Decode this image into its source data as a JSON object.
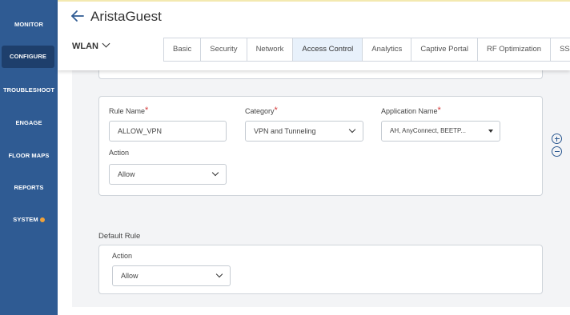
{
  "sidebar": {
    "items": [
      {
        "label": "MONITOR"
      },
      {
        "label": "CONFIGURE",
        "active": true
      },
      {
        "label": "TROUBLESHOOT"
      },
      {
        "label": "ENGAGE"
      },
      {
        "label": "FLOOR MAPS"
      },
      {
        "label": "REPORTS"
      },
      {
        "label": "SYSTEM",
        "badge_color": "#f0a23a"
      }
    ]
  },
  "header": {
    "title": "AristaGuest",
    "back_icon": "arrow-left-icon",
    "selector_label": "WLAN"
  },
  "tabs": [
    {
      "label": "Basic"
    },
    {
      "label": "Security"
    },
    {
      "label": "Network"
    },
    {
      "label": "Access Control",
      "active": true
    },
    {
      "label": "Analytics"
    },
    {
      "label": "Captive Portal"
    },
    {
      "label": "RF Optimization"
    },
    {
      "label": "SSID S"
    }
  ],
  "rule": {
    "rule_name_label": "Rule Name",
    "rule_name_value": "ALLOW_VPN",
    "category_label": "Category",
    "category_value": "VPN and Tunneling",
    "application_label": "Application Name",
    "application_value": "AH, AnyConnect, BEETP...",
    "action_label": "Action",
    "action_value": "Allow",
    "required_marker": "*"
  },
  "default_rule": {
    "title": "Default Rule",
    "action_label": "Action",
    "action_value": "Allow"
  },
  "colors": {
    "sidebar": "#2f5b93",
    "sidebar_active": "#1e3f6c",
    "accent": "#2f5b93",
    "required": "#d43838",
    "tab_active_bg": "#e8f1fb"
  }
}
